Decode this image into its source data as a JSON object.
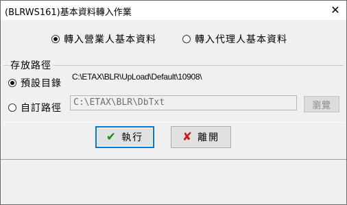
{
  "window": {
    "title": "(BLRWS161)基本資料轉入作業",
    "close_glyph": "✕"
  },
  "import_type": {
    "options": [
      {
        "label": "轉入營業人基本資料",
        "checked": true
      },
      {
        "label": "轉入代理人基本資料",
        "checked": false
      }
    ]
  },
  "storage": {
    "group_title": "存放路徑",
    "default_option_label": "預設目錄",
    "default_checked": true,
    "default_path": "C:\\ETAX\\BLR\\UpLoad\\Default\\10908\\",
    "custom_option_label": "自訂路徑",
    "custom_checked": false,
    "custom_path": "C:\\ETAX\\BLR\\DbTxt",
    "browse_label": "瀏覽"
  },
  "actions": {
    "execute_label": "執行",
    "execute_icon": "checkmark-icon",
    "execute_color": "#1a8a1a",
    "leave_label": "離開",
    "leave_icon": "cross-icon",
    "leave_color": "#c41e1e"
  }
}
